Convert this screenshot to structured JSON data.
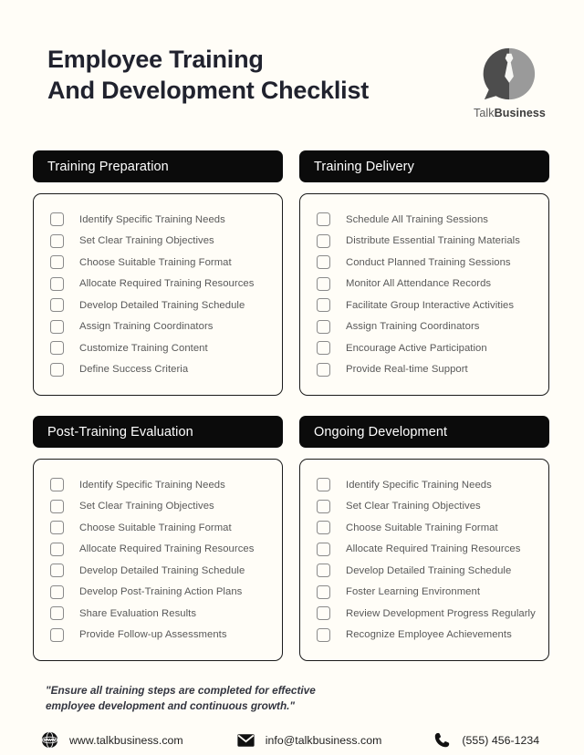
{
  "document": {
    "title_line1": "Employee Training",
    "title_line2": "And Development Checklist",
    "background_color": "#fffdf7",
    "accent_color": "#0b0b0b"
  },
  "logo": {
    "icon": "talkbusiness-speech-bubble-tie-logo",
    "name_light": "Talk",
    "name_bold": "Business"
  },
  "sections": [
    {
      "header": "Training Preparation",
      "items": [
        "Identify Specific Training Needs",
        "Set Clear Training Objectives",
        "Choose Suitable Training Format",
        "Allocate Required Training Resources",
        "Develop Detailed Training Schedule",
        "Assign Training Coordinators",
        "Customize Training Content",
        "Define Success Criteria"
      ]
    },
    {
      "header": "Training Delivery",
      "items": [
        "Schedule All Training Sessions",
        "Distribute Essential Training Materials",
        "Conduct Planned Training Sessions",
        "Monitor All Attendance Records",
        "Facilitate Group Interactive Activities",
        "Assign Training Coordinators",
        "Encourage Active Participation",
        "Provide Real-time Support"
      ]
    },
    {
      "header": "Post-Training Evaluation",
      "items": [
        "Identify Specific Training Needs",
        "Set Clear Training Objectives",
        "Choose Suitable Training Format",
        "Allocate Required Training Resources",
        "Develop Detailed Training Schedule",
        "Develop Post-Training Action Plans",
        "Share Evaluation Results",
        "Provide Follow-up Assessments"
      ]
    },
    {
      "header": "Ongoing Development",
      "items": [
        "Identify Specific Training Needs",
        "Set Clear Training Objectives",
        "Choose Suitable Training Format",
        "Allocate Required Training Resources",
        "Develop Detailed Training Schedule",
        "Foster Learning Environment",
        "Review Development Progress Regularly",
        "Recognize Employee Achievements"
      ]
    }
  ],
  "footer": {
    "quote": "\"Ensure all training steps are completed for effective employee development and continuous growth.\"",
    "contacts": [
      {
        "icon": "globe-www-icon",
        "text": "www.talkbusiness.com"
      },
      {
        "icon": "envelope-icon",
        "text": "info@talkbusiness.com"
      },
      {
        "icon": "phone-icon",
        "text": "(555) 456-1234"
      }
    ]
  }
}
